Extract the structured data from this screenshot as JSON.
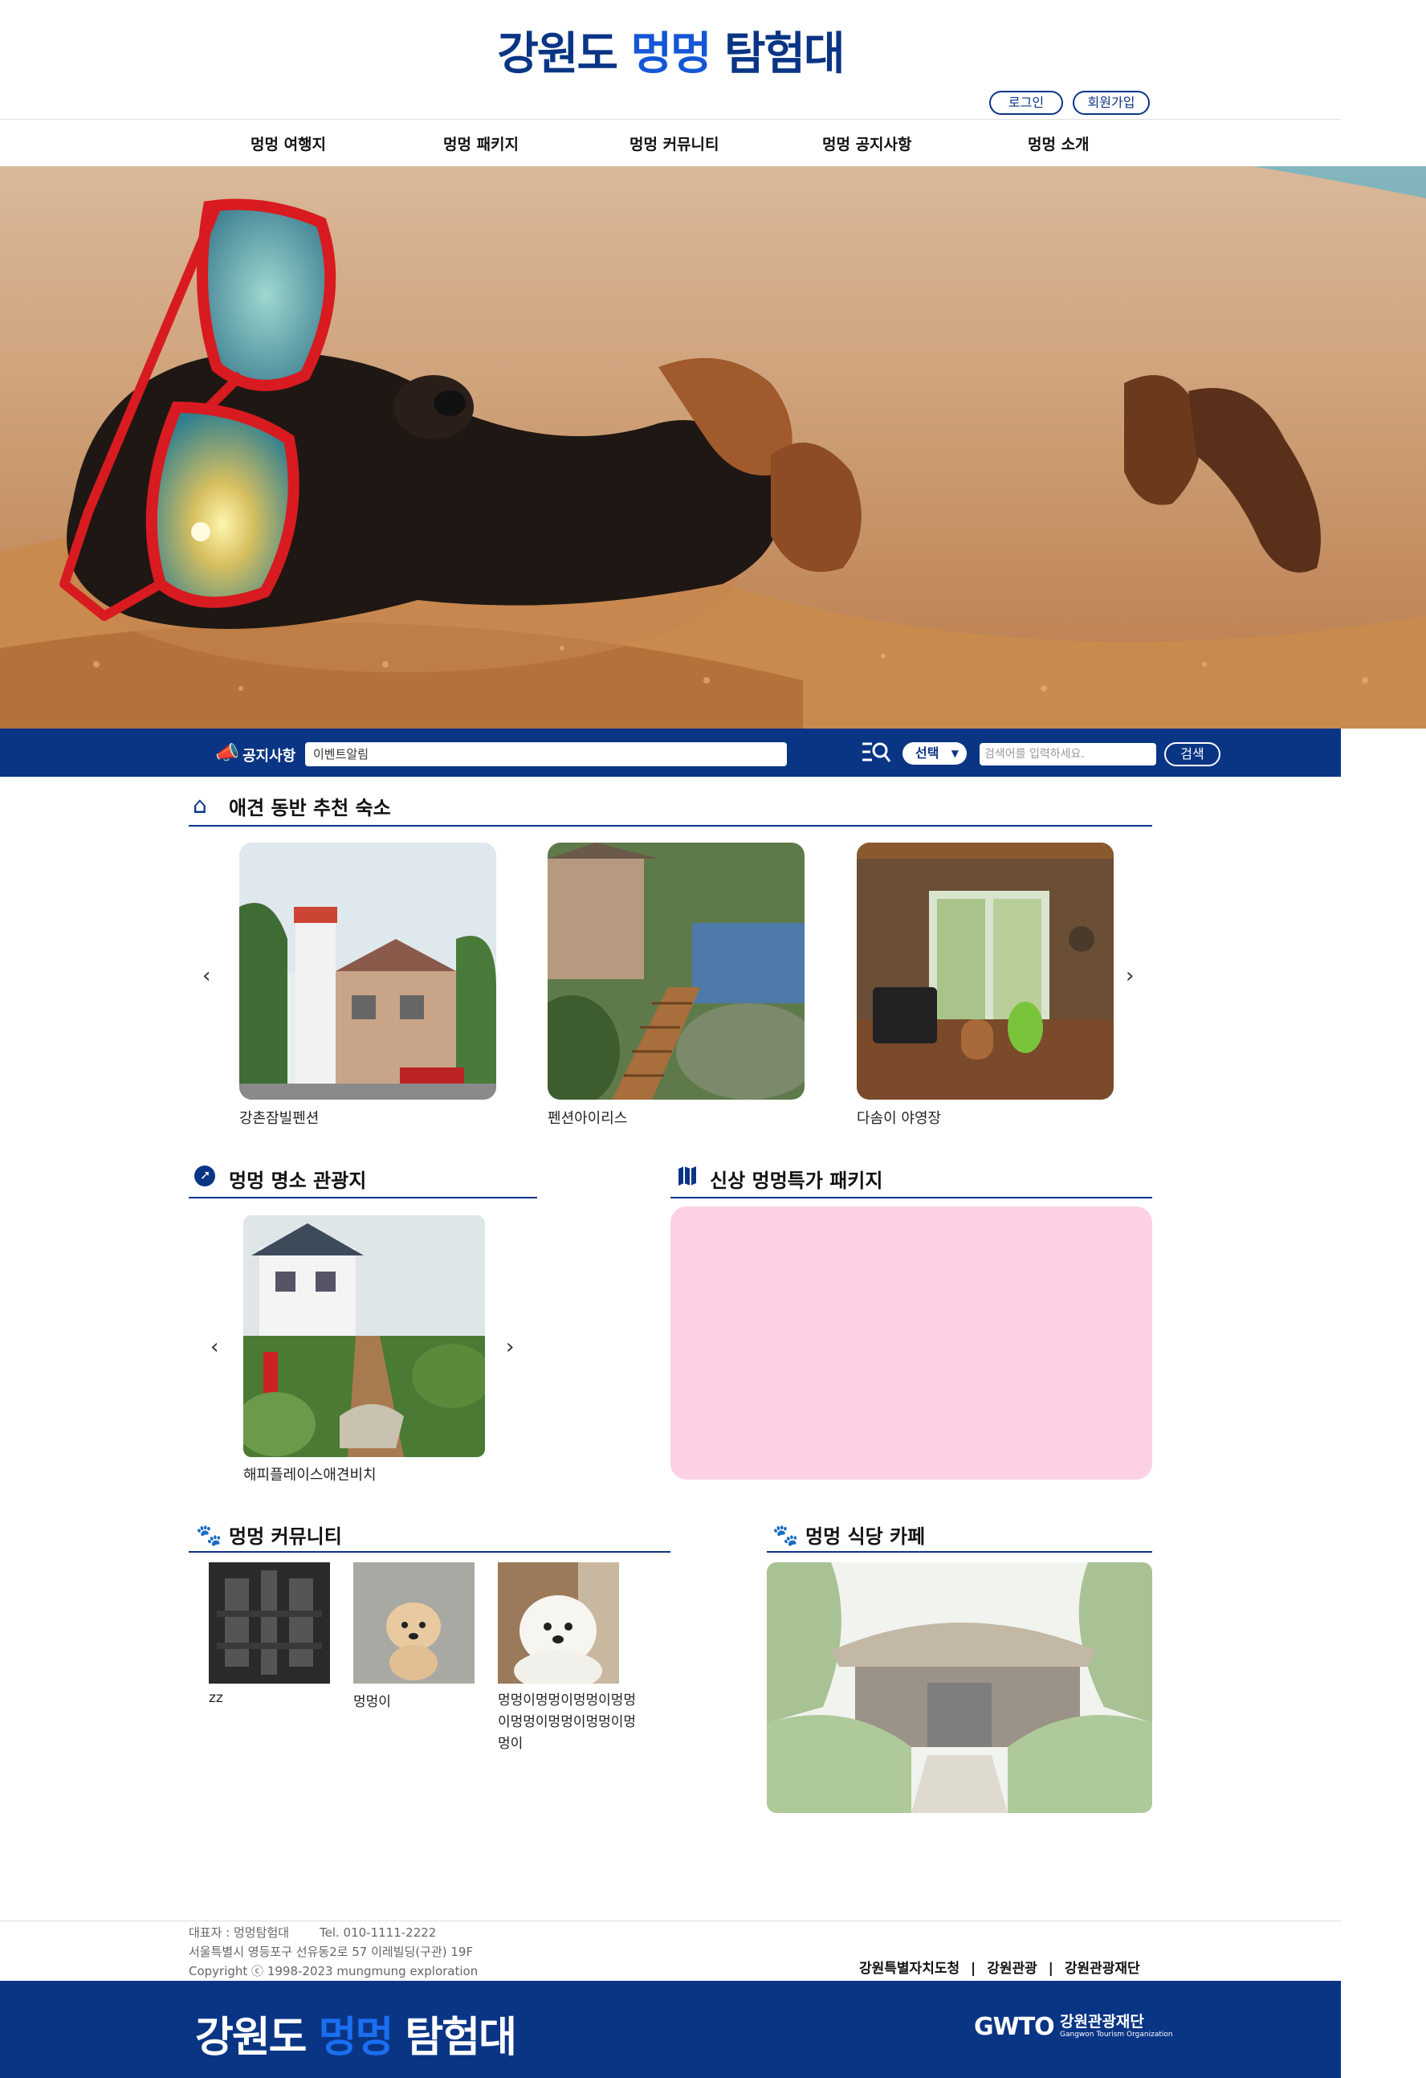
{
  "header": {
    "logo_part1": "강원도 ",
    "logo_highlight": "멍멍",
    "logo_part2": " 탐험대",
    "login_label": "로그인",
    "signup_label": "회원가입"
  },
  "nav": {
    "items": [
      "멍멍 여행지",
      "멍멍 패키지",
      "멍멍 커뮤니티",
      "멍멍 공지사항",
      "멍멍 소개"
    ]
  },
  "notice": {
    "label": "공지사항",
    "value": "이벤트알림",
    "select_value": "선택",
    "search_placeholder": "검색어를 입력하세요.",
    "search_button": "검색"
  },
  "accommodation": {
    "title": "애견 동반 추천 숙소",
    "prev": "‹",
    "next": "›",
    "items": [
      {
        "name": "강촌잠빌펜션"
      },
      {
        "name": "펜션아이리스"
      },
      {
        "name": "다솜이 야영장"
      }
    ]
  },
  "tour": {
    "title": "멍멍 명소 관광지",
    "prev": "‹",
    "next": "›",
    "item_name": "해피플레이스애견비치"
  },
  "package": {
    "title": "신상 멍멍특가 패키지"
  },
  "community": {
    "title": "멍멍 커뮤니티",
    "posts": [
      {
        "title": "zz"
      },
      {
        "title": "멍멍이"
      },
      {
        "title": "멍멍이멍멍이멍멍이멍멍이멍멍이멍멍이멍멍이멍멍이"
      }
    ]
  },
  "cafe": {
    "title": "멍멍 식당 카페"
  },
  "footer": {
    "rep": "대표자 : 멍멍탐험대",
    "tel": "Tel. 010-1111-2222",
    "address": "서울특별시 영등포구 선유동2로 57 이레빌딩(구관) 19F",
    "copyright": "Copyright ⓒ 1998-2023 mungmung exploration",
    "links": [
      "강원특별자치도청",
      "강원관광",
      "강원관광재단"
    ],
    "gwto_mark": "GWTO",
    "gwto_name": "강원관광재단",
    "gwto_sub": "Gangwon Tourism Organization"
  }
}
